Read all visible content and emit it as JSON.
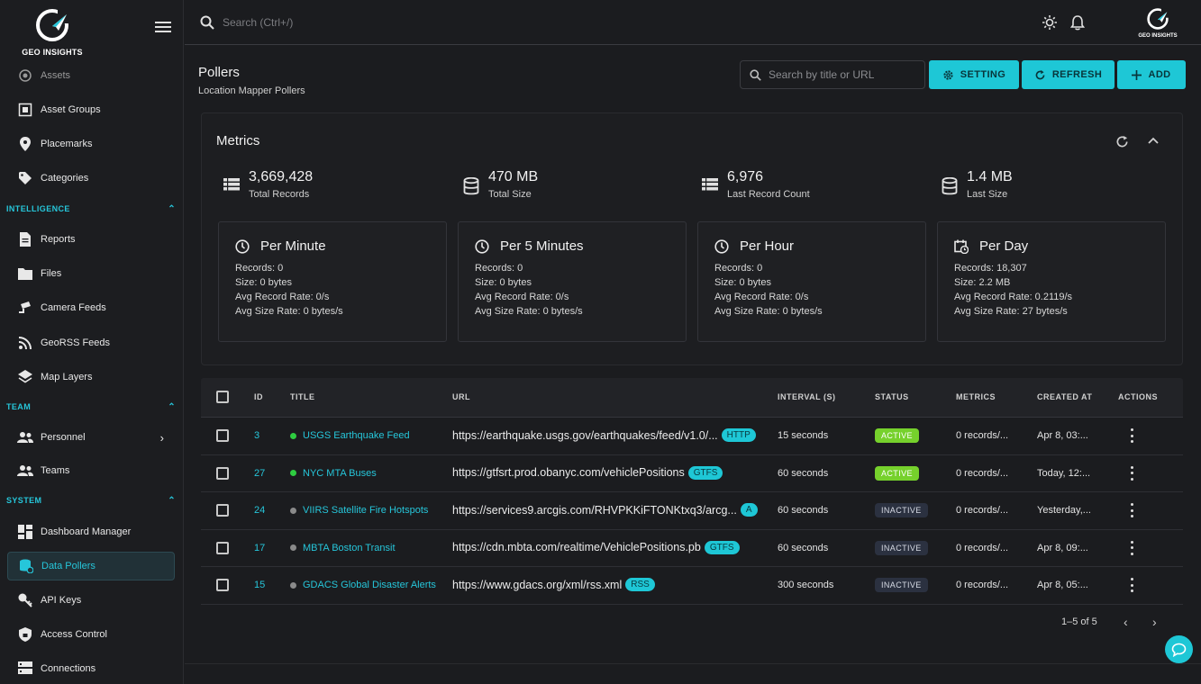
{
  "brand": {
    "name": "GEO INSIGHTS"
  },
  "sidebar": {
    "items": [
      {
        "label": "Assets",
        "icon": "asset-target-icon"
      },
      {
        "label": "Asset Groups",
        "icon": "asset-groups-icon"
      },
      {
        "label": "Placemarks",
        "icon": "placemark-pin-icon"
      },
      {
        "label": "Categories",
        "icon": "tag-icon"
      }
    ],
    "sections": [
      {
        "label": "INTELLIGENCE",
        "items": [
          {
            "label": "Reports"
          },
          {
            "label": "Files"
          },
          {
            "label": "Camera Feeds"
          },
          {
            "label": "GeoRSS Feeds"
          },
          {
            "label": "Map Layers"
          }
        ]
      },
      {
        "label": "TEAM",
        "items": [
          {
            "label": "Personnel"
          },
          {
            "label": "Teams"
          }
        ]
      },
      {
        "label": "SYSTEM",
        "items": [
          {
            "label": "Dashboard Manager"
          },
          {
            "label": "Data Pollers"
          },
          {
            "label": "API Keys"
          },
          {
            "label": "Access Control"
          },
          {
            "label": "Connections"
          }
        ]
      }
    ]
  },
  "topbar": {
    "search_placeholder": "Search (Ctrl+/)",
    "logo_text": "GEO INSIGHTS"
  },
  "page": {
    "title": "Pollers",
    "subtitle": "Location Mapper Pollers"
  },
  "toolbar": {
    "search_placeholder": "Search by title or URL",
    "setting_label": "SETTING",
    "refresh_label": "REFRESH",
    "add_label": "ADD"
  },
  "metrics": {
    "title": "Metrics",
    "stats": [
      {
        "value": "3,669,428",
        "caption": "Total Records"
      },
      {
        "value": "470 MB",
        "caption": "Total Size"
      },
      {
        "value": "6,976",
        "caption": "Last Record Count"
      },
      {
        "value": "1.4 MB",
        "caption": "Last Size"
      }
    ],
    "periods": [
      {
        "title": "Per Minute",
        "lines": [
          "Records: 0",
          "Size: 0 bytes",
          "Avg Record Rate: 0/s",
          "Avg Size Rate: 0 bytes/s"
        ]
      },
      {
        "title": "Per 5 Minutes",
        "lines": [
          "Records: 0",
          "Size: 0 bytes",
          "Avg Record Rate: 0/s",
          "Avg Size Rate: 0 bytes/s"
        ]
      },
      {
        "title": "Per Hour",
        "lines": [
          "Records: 0",
          "Size: 0 bytes",
          "Avg Record Rate: 0/s",
          "Avg Size Rate: 0 bytes/s"
        ]
      },
      {
        "title": "Per Day",
        "lines": [
          "Records: 18,307",
          "Size: 2.2 MB",
          "Avg Record Rate: 0.2119/s",
          "Avg Size Rate: 27 bytes/s"
        ]
      }
    ]
  },
  "table": {
    "headers": [
      "ID",
      "TITLE",
      "URL",
      "INTERVAL (S)",
      "STATUS",
      "METRICS",
      "CREATED AT",
      "ACTIONS"
    ],
    "rows": [
      {
        "id": "3",
        "title": "USGS Earthquake Feed",
        "url": "https://earthquake.usgs.gov/earthquakes/feed/v1.0/...",
        "type": "HTTP",
        "interval": "15 seconds",
        "status": "ACTIVE",
        "metrics": "0 records/...",
        "created": "Apr 8, 03:..."
      },
      {
        "id": "27",
        "title": "NYC MTA Buses",
        "url": "https://gtfsrt.prod.obanyc.com/vehiclePositions",
        "type": "GTFS",
        "interval": "60 seconds",
        "status": "ACTIVE",
        "metrics": "0 records/...",
        "created": "Today, 12:..."
      },
      {
        "id": "24",
        "title": "VIIRS Satellite Fire Hotspots",
        "url": "https://services9.arcgis.com/RHVPKKiFTONKtxq3/arcg...",
        "type": "A",
        "interval": "60 seconds",
        "status": "INACTIVE",
        "metrics": "0 records/...",
        "created": "Yesterday,..."
      },
      {
        "id": "17",
        "title": "MBTA Boston Transit",
        "url": "https://cdn.mbta.com/realtime/VehiclePositions.pb",
        "type": "GTFS",
        "interval": "60 seconds",
        "status": "INACTIVE",
        "metrics": "0 records/...",
        "created": "Apr 8, 09:..."
      },
      {
        "id": "15",
        "title": "GDACS Global Disaster Alerts",
        "url": "https://www.gdacs.org/xml/rss.xml",
        "type": "RSS",
        "interval": "300 seconds",
        "status": "INACTIVE",
        "metrics": "0 records/...",
        "created": "Apr 8, 05:..."
      }
    ]
  },
  "pagination": {
    "range": "1–5 of 5"
  },
  "colors": {
    "accent": "#1ec7d6",
    "active": "#76d12c",
    "inactive": "#2b3140",
    "background": "#1b1c1f"
  }
}
